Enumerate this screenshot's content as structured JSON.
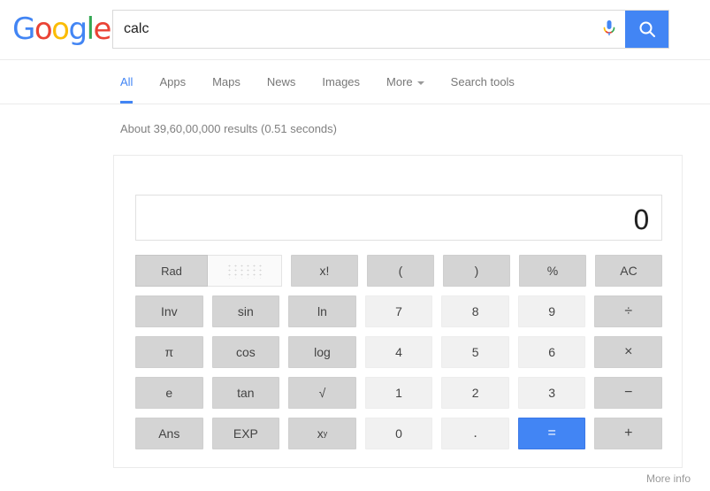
{
  "header": {
    "logo_letters": [
      {
        "ch": "G",
        "color": "#4285f4"
      },
      {
        "ch": "o",
        "color": "#ea4335"
      },
      {
        "ch": "o",
        "color": "#fbbc05"
      },
      {
        "ch": "g",
        "color": "#4285f4"
      },
      {
        "ch": "l",
        "color": "#34a853"
      },
      {
        "ch": "e",
        "color": "#ea4335"
      }
    ],
    "logo_text": "Google",
    "search_value": "calc",
    "search_placeholder": "",
    "mic_icon": "microphone-icon",
    "search_icon": "search-icon",
    "search_button_color": "#4285f4"
  },
  "nav": {
    "items": [
      {
        "label": "All",
        "active": true
      },
      {
        "label": "Apps",
        "active": false
      },
      {
        "label": "Maps",
        "active": false
      },
      {
        "label": "News",
        "active": false
      },
      {
        "label": "Images",
        "active": false
      },
      {
        "label": "More",
        "active": false,
        "caret": true
      },
      {
        "label": "Search tools",
        "active": false
      }
    ],
    "active_color": "#4285f4",
    "inactive_color": "#777777"
  },
  "results": {
    "stats": "About 39,60,00,000 results (0.51 seconds)"
  },
  "calculator": {
    "display_value": "0",
    "mode_toggle": {
      "rad_label": "Rad",
      "rad_selected": true,
      "deg_label": "",
      "deg_placeholder_icon": "dot-grid-loading-icon"
    },
    "rows": [
      [
        {
          "label": "x!",
          "type": "fn",
          "name": "factorial"
        },
        {
          "label": "(",
          "type": "fn",
          "name": "open-paren"
        },
        {
          "label": ")",
          "type": "fn",
          "name": "close-paren"
        },
        {
          "label": "%",
          "type": "fn",
          "name": "percent"
        },
        {
          "label": "AC",
          "type": "fn",
          "name": "all-clear"
        }
      ],
      [
        {
          "label": "Inv",
          "type": "fn",
          "name": "inverse"
        },
        {
          "label": "sin",
          "type": "fn",
          "name": "sin"
        },
        {
          "label": "ln",
          "type": "fn",
          "name": "ln"
        },
        {
          "label": "7",
          "type": "num",
          "name": "digit-7"
        },
        {
          "label": "8",
          "type": "num",
          "name": "digit-8"
        },
        {
          "label": "9",
          "type": "num",
          "name": "digit-9"
        },
        {
          "label": "÷",
          "type": "op",
          "name": "divide"
        }
      ],
      [
        {
          "label": "π",
          "type": "fn",
          "name": "pi"
        },
        {
          "label": "cos",
          "type": "fn",
          "name": "cos"
        },
        {
          "label": "log",
          "type": "fn",
          "name": "log"
        },
        {
          "label": "4",
          "type": "num",
          "name": "digit-4"
        },
        {
          "label": "5",
          "type": "num",
          "name": "digit-5"
        },
        {
          "label": "6",
          "type": "num",
          "name": "digit-6"
        },
        {
          "label": "×",
          "type": "op",
          "name": "multiply"
        }
      ],
      [
        {
          "label": "e",
          "type": "fn",
          "name": "euler-e"
        },
        {
          "label": "tan",
          "type": "fn",
          "name": "tan"
        },
        {
          "label": "√",
          "type": "fn",
          "name": "square-root"
        },
        {
          "label": "1",
          "type": "num",
          "name": "digit-1"
        },
        {
          "label": "2",
          "type": "num",
          "name": "digit-2"
        },
        {
          "label": "3",
          "type": "num",
          "name": "digit-3"
        },
        {
          "label": "−",
          "type": "op",
          "name": "minus"
        }
      ],
      [
        {
          "label": "Ans",
          "type": "fn",
          "name": "answer"
        },
        {
          "label": "EXP",
          "type": "fn",
          "name": "exponent"
        },
        {
          "label": "x",
          "sup": "y",
          "type": "fn",
          "name": "power"
        },
        {
          "label": "0",
          "type": "num",
          "name": "digit-0"
        },
        {
          "label": ".",
          "type": "num",
          "name": "decimal-point"
        },
        {
          "label": "=",
          "type": "eq",
          "name": "equals"
        },
        {
          "label": "+",
          "type": "op",
          "name": "plus"
        }
      ]
    ],
    "equals_color": "#4285f4"
  },
  "footer": {
    "more_info": "More info"
  }
}
